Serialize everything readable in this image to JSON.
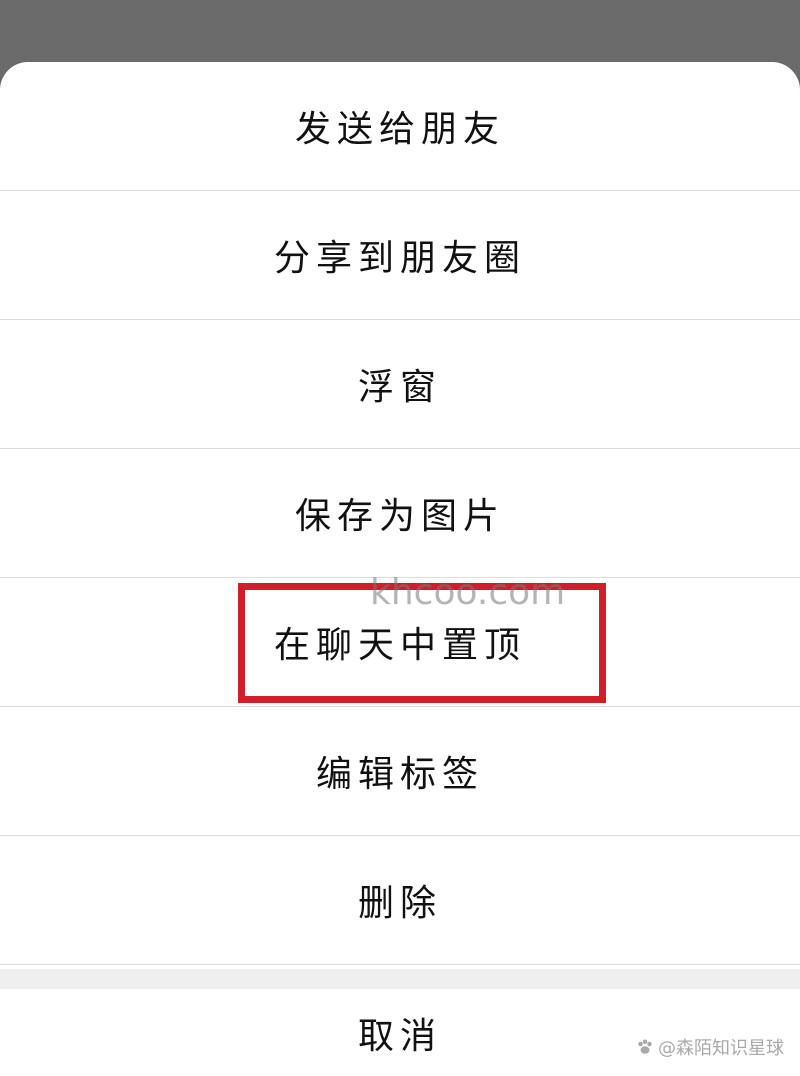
{
  "menu": {
    "items": [
      {
        "label": "发送给朋友"
      },
      {
        "label": "分享到朋友圈"
      },
      {
        "label": "浮窗"
      },
      {
        "label": "保存为图片"
      },
      {
        "label": "在聊天中置顶"
      },
      {
        "label": "编辑标签"
      },
      {
        "label": "删除"
      }
    ],
    "cancel_label": "取消"
  },
  "overlays": {
    "watermark_text": "khcoo.com",
    "corner_watermark_text": "@森陌知识星球",
    "highlight_color": "#d11f2a"
  }
}
